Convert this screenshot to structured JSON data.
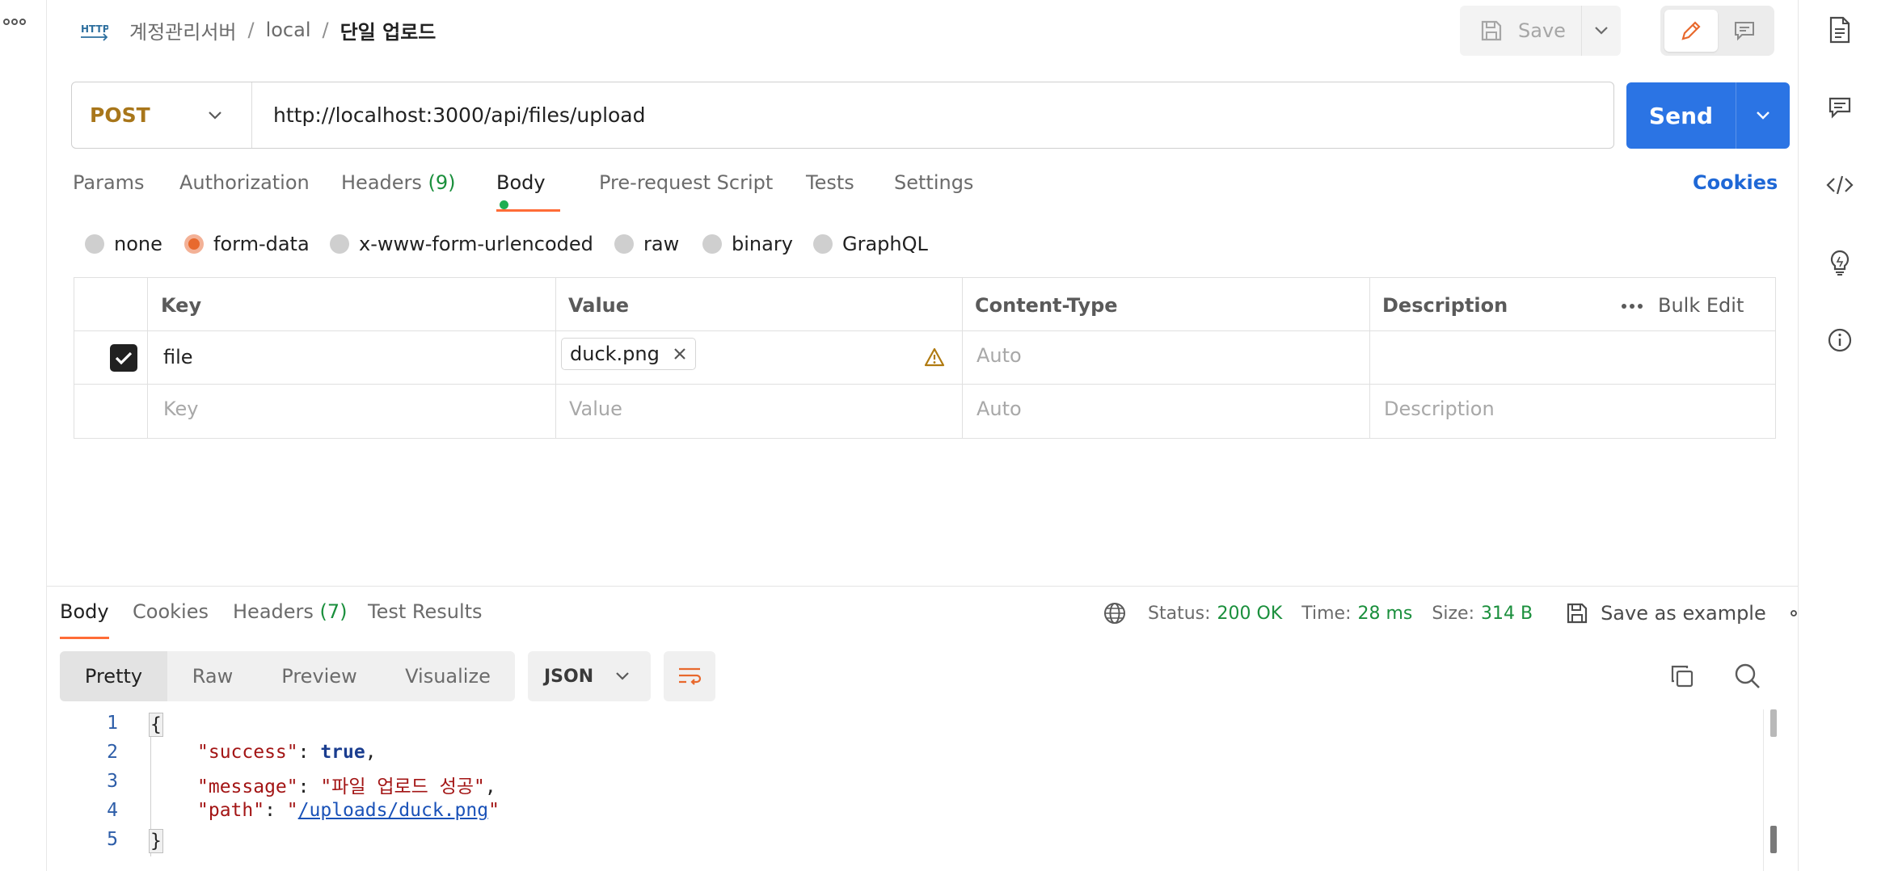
{
  "breadcrumb": {
    "collection": "계정관리서버",
    "folder": "local",
    "request": "단일 업로드"
  },
  "toolbar": {
    "save_label": "Save"
  },
  "request": {
    "method": "POST",
    "url": "http://localhost:3000/api/files/upload",
    "send_label": "Send"
  },
  "request_tabs": {
    "params": "Params",
    "authorization": "Authorization",
    "headers": "Headers",
    "headers_count": "(9)",
    "body": "Body",
    "prerequest": "Pre-request Script",
    "tests": "Tests",
    "settings": "Settings",
    "cookies": "Cookies",
    "active": "Body"
  },
  "body_types": {
    "options": [
      "none",
      "form-data",
      "x-www-form-urlencoded",
      "raw",
      "binary",
      "GraphQL"
    ],
    "selected": "form-data"
  },
  "form_table": {
    "headers": {
      "key": "Key",
      "value": "Value",
      "content_type": "Content-Type",
      "description": "Description",
      "bulk_edit": "Bulk Edit"
    },
    "rows": [
      {
        "checked": true,
        "key": "file",
        "value_file": "duck.png",
        "content_type_placeholder": "Auto"
      }
    ],
    "placeholder_row": {
      "key": "Key",
      "value": "Value",
      "content_type": "Auto",
      "description": "Description"
    }
  },
  "response_tabs": {
    "body": "Body",
    "cookies": "Cookies",
    "headers": "Headers",
    "headers_count": "(7)",
    "test_results": "Test Results",
    "active": "Body"
  },
  "response_meta": {
    "status_label": "Status:",
    "status_value": "200 OK",
    "time_label": "Time:",
    "time_value": "28 ms",
    "size_label": "Size:",
    "size_value": "314 B",
    "save_example": "Save as example"
  },
  "format": {
    "tabs": [
      "Pretty",
      "Raw",
      "Preview",
      "Visualize"
    ],
    "active": "Pretty",
    "language": "JSON"
  },
  "response_body": {
    "line_numbers": [
      "1",
      "2",
      "3",
      "4",
      "5"
    ],
    "open_brace": "{",
    "close_brace": "}",
    "success_key": "\"success\"",
    "success_value": "true",
    "message_key": "\"message\"",
    "message_value": "\"파일 업로드 성공\"",
    "path_key": "\"path\"",
    "path_value": "/uploads/duck.png"
  },
  "colors": {
    "accent_tab": "#ff6c37",
    "send_button": "#2b74e4",
    "method_post": "#a8761a",
    "status_ok": "#1a8f3c"
  },
  "icons": [
    "more-icon",
    "http-icon",
    "save-icon",
    "chevron-down-icon",
    "pencil-icon",
    "comment-icon",
    "document-icon",
    "code-icon",
    "bulb-icon",
    "info-icon",
    "check-icon",
    "close-icon",
    "warning-icon",
    "globe-icon",
    "wrap-icon",
    "copy-icon",
    "search-icon"
  ]
}
